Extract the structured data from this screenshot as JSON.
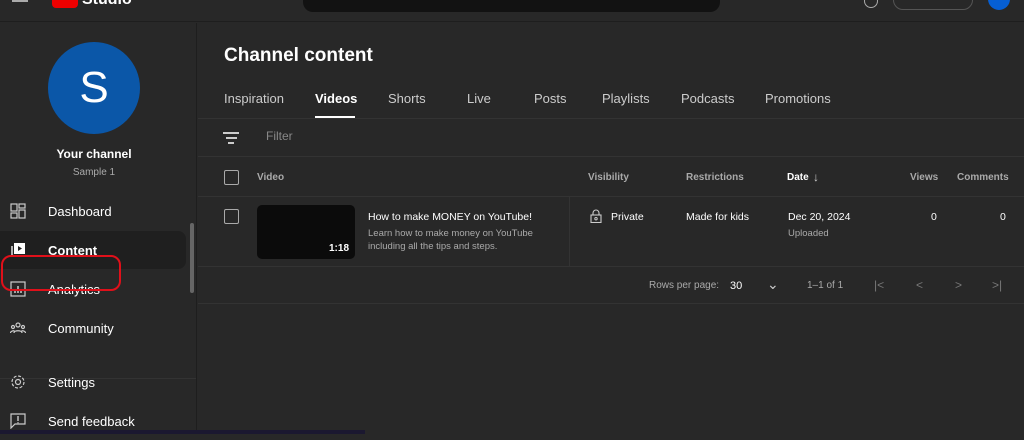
{
  "header": {
    "logo_text": "Studio",
    "search_placeholder": ""
  },
  "sidebar": {
    "avatar_letter": "S",
    "channel_label": "Your channel",
    "channel_name": "Sample 1",
    "items": [
      {
        "label": "Dashboard"
      },
      {
        "label": "Content"
      },
      {
        "label": "Analytics"
      },
      {
        "label": "Community"
      }
    ],
    "bottom_items": [
      {
        "label": "Settings"
      },
      {
        "label": "Send feedback"
      }
    ],
    "active": "Content",
    "highlight_color": "#e0101a"
  },
  "main": {
    "title": "Channel content",
    "tabs": [
      {
        "label": "Inspiration"
      },
      {
        "label": "Videos"
      },
      {
        "label": "Shorts"
      },
      {
        "label": "Live"
      },
      {
        "label": "Posts"
      },
      {
        "label": "Playlists"
      },
      {
        "label": "Podcasts"
      },
      {
        "label": "Promotions"
      }
    ],
    "active_tab": "Videos",
    "filter_placeholder": "Filter",
    "columns": {
      "video": "Video",
      "visibility": "Visibility",
      "restrictions": "Restrictions",
      "date": "Date",
      "views": "Views",
      "comments": "Comments"
    },
    "rows": [
      {
        "title": "How to make MONEY on YouTube!",
        "description": "Learn how to make money on YouTube including all the tips and steps.",
        "duration": "1:18",
        "visibility": "Private",
        "restrictions": "Made for kids",
        "date": "Dec 20, 2024",
        "date_status": "Uploaded",
        "views": "0",
        "comments": "0"
      }
    ],
    "pagination": {
      "rows_per_page_label": "Rows per page:",
      "rows_per_page": "30",
      "range": "1–1 of 1"
    }
  }
}
